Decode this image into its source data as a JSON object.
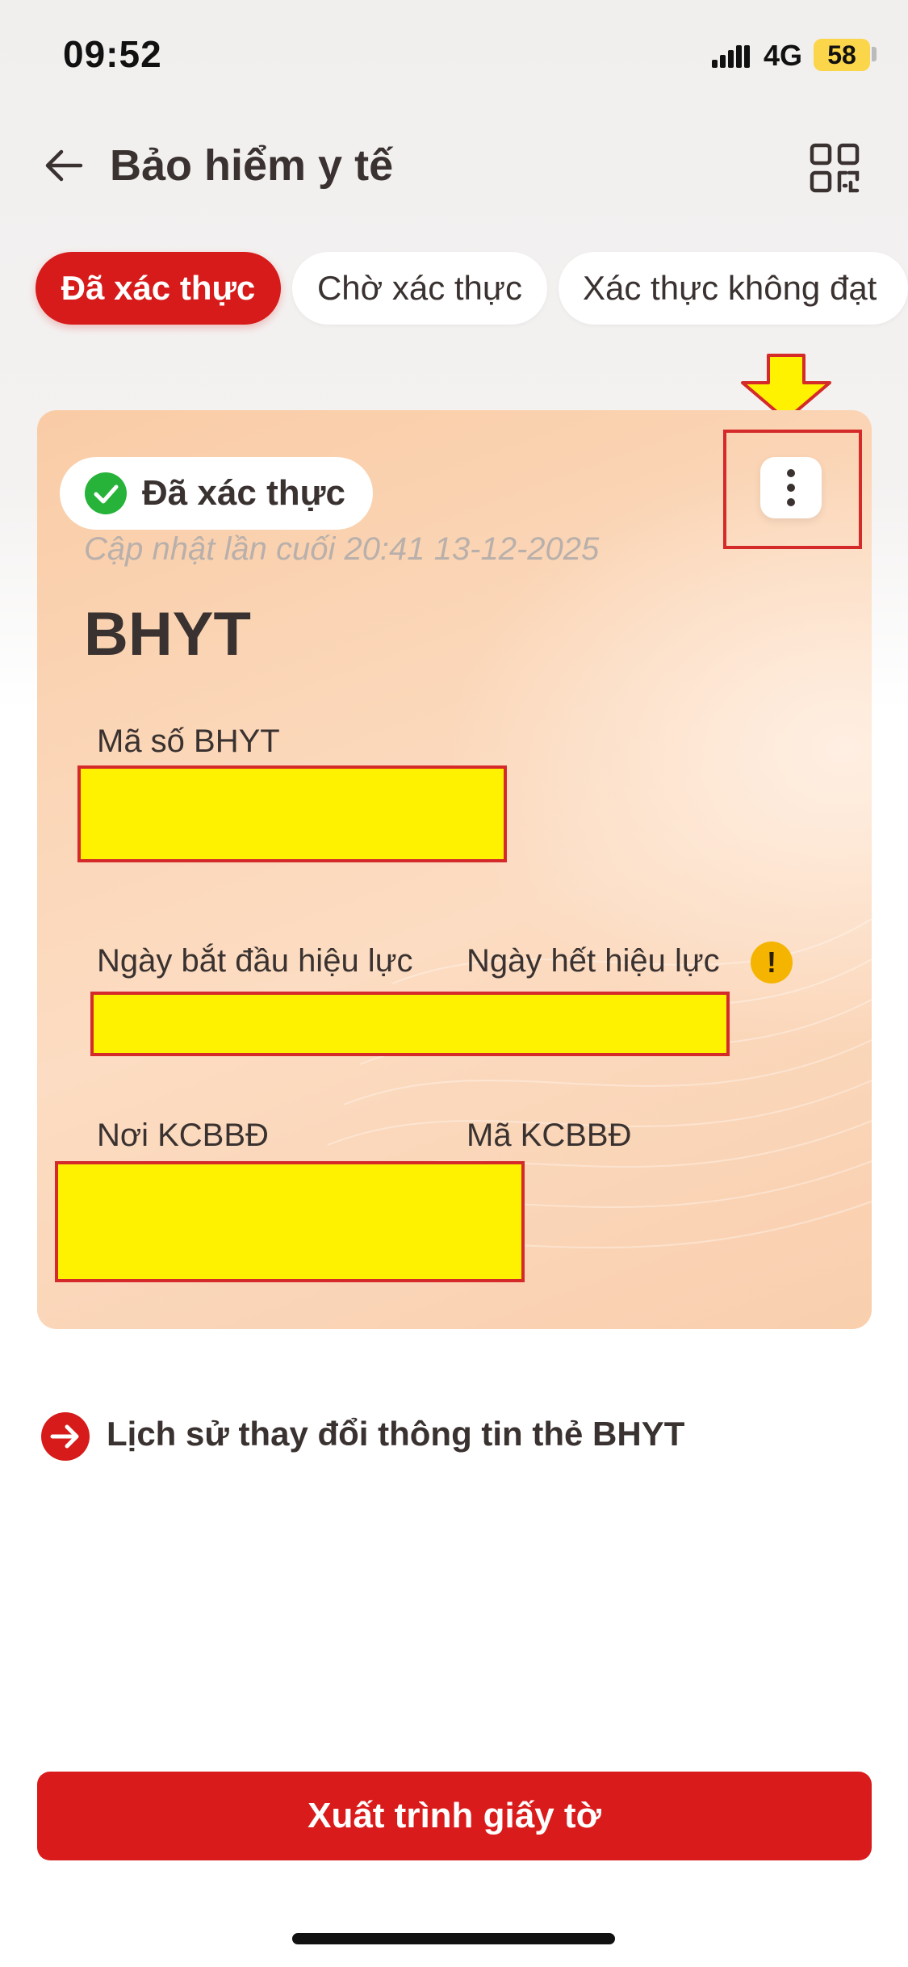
{
  "status_bar": {
    "time": "09:52",
    "network": "4G",
    "battery": "58"
  },
  "header": {
    "title": "Bảo hiểm y tế",
    "back_icon": "arrow-left-icon",
    "qr_icon": "qr-code-icon"
  },
  "tabs": [
    {
      "label": "Đã xác thực",
      "active": true
    },
    {
      "label": "Chờ xác thực",
      "active": false
    },
    {
      "label": "Xác thực không đạt",
      "active": false
    }
  ],
  "card": {
    "status_badge": "Đã xác thực",
    "last_updated": "Cập nhật lần cuối 20:41 13-12-2025",
    "card_type": "BHYT",
    "fields": {
      "ma_so_label": "Mã số BHYT",
      "start_label": "Ngày bắt đầu hiệu lực",
      "end_label": "Ngày hết hiệu lực",
      "warning_mark": "!",
      "noi_label": "Nơi KCBBĐ",
      "ma_kcb_label": "Mã KCBBĐ"
    },
    "menu_icon": "more-vertical-icon"
  },
  "history_link": {
    "label": "Lịch sử thay đổi thông tin thẻ BHYT",
    "icon": "arrow-right-circle-icon"
  },
  "primary_button": {
    "label": "Xuất trình giấy tờ"
  },
  "colors": {
    "brand_red": "#d71a1a",
    "highlight_yellow": "#fff200",
    "card_peach": "#fbd7b9",
    "success_green": "#27b33a",
    "warning_amber": "#f5b400"
  }
}
